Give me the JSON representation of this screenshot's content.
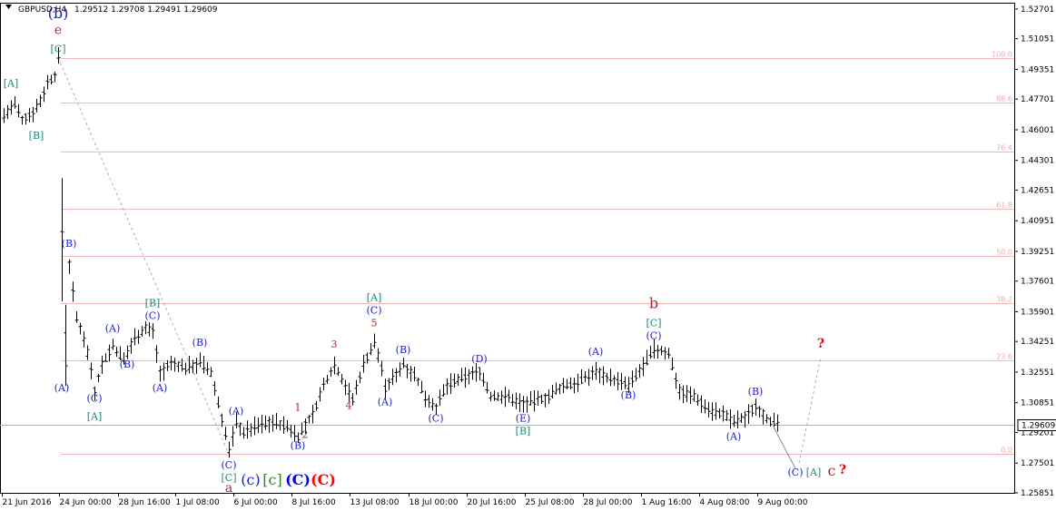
{
  "header": {
    "symbol": "GBPUSD,H4",
    "ohlc": "1.29512 1.29708 1.29491 1.29609"
  },
  "colors": {
    "background": "#ffffff",
    "candle": "#000000",
    "fib_line": "#f4b6b6",
    "fib_text": "#f4a6a6",
    "blue_label": "#1c1cd6",
    "teal_label": "#1a8a7a",
    "red_label": "#a52a2a",
    "green_label": "#2e7d32",
    "bright_blue": "#0000ff",
    "bright_red": "#ff0000",
    "current_price_line": "#b0b0b0",
    "trend_dash": "#b0b0b0"
  },
  "chart_data": {
    "type": "ohlc",
    "title": "",
    "y_axis": {
      "ticks": [
        "1.52701",
        "1.51051",
        "1.49351",
        "1.47701",
        "1.46001",
        "1.44301",
        "1.42651",
        "1.40951",
        "1.39251",
        "1.37601",
        "1.35901",
        "1.34251",
        "1.32551",
        "1.30851",
        "1.29201",
        "1.27501",
        "1.25851"
      ],
      "range": [
        1.2585,
        1.5305
      ],
      "current_price": "1.29609"
    },
    "x_axis": {
      "ticks": [
        "21 Jun 2016",
        "24 Jun 00:00",
        "28 Jun 16:00",
        "1 Jul 08:00",
        "6 Jul 00:00",
        "8 Jul 16:00",
        "13 Jul 08:00",
        "18 Jul 00:00",
        "20 Jul 16:00",
        "25 Jul 08:00",
        "28 Jul 00:00",
        "1 Aug 16:00",
        "4 Aug 08:00",
        "9 Aug 00:00"
      ]
    },
    "fib_levels": [
      {
        "label": "100.0",
        "price": 1.5
      },
      {
        "label": "88.6",
        "price": 1.475
      },
      {
        "label": "76.4",
        "price": 1.448
      },
      {
        "label": "61.8",
        "price": 1.416
      },
      {
        "label": "50.0",
        "price": 1.39
      },
      {
        "label": "38.2",
        "price": 1.364
      },
      {
        "label": "23.6",
        "price": 1.332
      },
      {
        "label": "0.0",
        "price": 1.28
      }
    ],
    "bar_count": 220,
    "bars": [],
    "wave_labels": [
      {
        "text": "(b)",
        "bar": 15,
        "price": 1.522,
        "color": "blue_label",
        "size": 16
      },
      {
        "text": "e",
        "bar": 15,
        "price": 1.513,
        "color": "red_label",
        "size": 14
      },
      {
        "text": "[C]",
        "bar": 15,
        "price": 1.503,
        "color": "teal_label",
        "size": 11
      },
      {
        "text": "[A]",
        "bar": 2,
        "price": 1.484,
        "color": "teal_label",
        "size": 11
      },
      {
        "text": "[B]",
        "bar": 9,
        "price": 1.455,
        "color": "teal_label",
        "size": 11
      },
      {
        "text": "(B)",
        "bar": 18,
        "price": 1.395,
        "color": "blue_label",
        "size": 11
      },
      {
        "text": "(A)",
        "bar": 16,
        "price": 1.315,
        "color": "blue_label",
        "size": 11
      },
      {
        "text": "(C)",
        "bar": 25,
        "price": 1.309,
        "color": "blue_label",
        "size": 11
      },
      {
        "text": "[A]",
        "bar": 25,
        "price": 1.299,
        "color": "teal_label",
        "size": 11
      },
      {
        "text": "(A)",
        "bar": 30,
        "price": 1.348,
        "color": "blue_label",
        "size": 11
      },
      {
        "text": "(B)",
        "bar": 34,
        "price": 1.328,
        "color": "blue_label",
        "size": 11
      },
      {
        "text": "[B]",
        "bar": 41,
        "price": 1.362,
        "color": "teal_label",
        "size": 11
      },
      {
        "text": "(C)",
        "bar": 41,
        "price": 1.355,
        "color": "blue_label",
        "size": 11
      },
      {
        "text": "(A)",
        "bar": 43,
        "price": 1.315,
        "color": "blue_label",
        "size": 11
      },
      {
        "text": "(B)",
        "bar": 54,
        "price": 1.34,
        "color": "blue_label",
        "size": 11
      },
      {
        "text": "(A)",
        "bar": 64,
        "price": 1.302,
        "color": "blue_label",
        "size": 11
      },
      {
        "text": "(C)",
        "bar": 62,
        "price": 1.272,
        "color": "blue_label",
        "size": 11
      },
      {
        "text": "[C]",
        "bar": 62,
        "price": 1.265,
        "color": "teal_label",
        "size": 11
      },
      {
        "text": "a",
        "bar": 62,
        "price": 1.259,
        "color": "red_label",
        "size": 14
      },
      {
        "text": "(c)",
        "bar": 68,
        "price": 1.263,
        "color": "blue_label",
        "size": 16
      },
      {
        "text": "[c]",
        "bar": 74,
        "price": 1.263,
        "color": "green_label",
        "size": 16
      },
      {
        "text": "(C)",
        "bar": 81,
        "price": 1.263,
        "color": "bright_blue",
        "size": 16
      },
      {
        "text": "(C)",
        "bar": 88,
        "price": 1.263,
        "color": "bright_red",
        "size": 16
      },
      {
        "text": "(B)",
        "bar": 81,
        "price": 1.283,
        "color": "blue_label",
        "size": 11
      },
      {
        "text": "1",
        "bar": 81,
        "price": 1.304,
        "color": "red_label",
        "size": 11
      },
      {
        "text": "2",
        "bar": 83,
        "price": 1.289,
        "color": "red_label",
        "size": 11
      },
      {
        "text": "3",
        "bar": 91,
        "price": 1.339,
        "color": "red_label",
        "size": 11
      },
      {
        "text": "4",
        "bar": 95,
        "price": 1.305,
        "color": "red_label",
        "size": 11
      },
      {
        "text": "[A]",
        "bar": 102,
        "price": 1.365,
        "color": "teal_label",
        "size": 11
      },
      {
        "text": "(C)",
        "bar": 102,
        "price": 1.358,
        "color": "blue_label",
        "size": 11
      },
      {
        "text": "5",
        "bar": 102,
        "price": 1.351,
        "color": "red_label",
        "size": 11
      },
      {
        "text": "(A)",
        "bar": 105,
        "price": 1.307,
        "color": "blue_label",
        "size": 11
      },
      {
        "text": "(B)",
        "bar": 110,
        "price": 1.336,
        "color": "blue_label",
        "size": 11
      },
      {
        "text": "(C)",
        "bar": 119,
        "price": 1.298,
        "color": "blue_label",
        "size": 11
      },
      {
        "text": "(D)",
        "bar": 131,
        "price": 1.331,
        "color": "blue_label",
        "size": 11
      },
      {
        "text": "(E)",
        "bar": 143,
        "price": 1.298,
        "color": "blue_label",
        "size": 11
      },
      {
        "text": "[B]",
        "bar": 143,
        "price": 1.291,
        "color": "teal_label",
        "size": 11
      },
      {
        "text": "(A)",
        "bar": 163,
        "price": 1.335,
        "color": "blue_label",
        "size": 11
      },
      {
        "text": "(B)",
        "bar": 172,
        "price": 1.311,
        "color": "blue_label",
        "size": 11
      },
      {
        "text": "b",
        "bar": 179,
        "price": 1.361,
        "color": "red_label",
        "size": 16
      },
      {
        "text": "[C]",
        "bar": 179,
        "price": 1.351,
        "color": "teal_label",
        "size": 11
      },
      {
        "text": "(C)",
        "bar": 179,
        "price": 1.344,
        "color": "blue_label",
        "size": 11
      },
      {
        "text": "(A)",
        "bar": 201,
        "price": 1.288,
        "color": "blue_label",
        "size": 11
      },
      {
        "text": "(B)",
        "bar": 207,
        "price": 1.313,
        "color": "blue_label",
        "size": 11
      },
      {
        "text": "(C)",
        "bar": 218,
        "price": 1.268,
        "color": "blue_label",
        "size": 11
      },
      {
        "text": "[A]",
        "bar": 223,
        "price": 1.268,
        "color": "teal_label",
        "size": 11
      },
      {
        "text": "c",
        "bar": 228,
        "price": 1.268,
        "color": "red_label",
        "size": 16
      },
      {
        "text": "?",
        "bar": 231,
        "price": 1.269,
        "color": "bright_red",
        "size": 14
      },
      {
        "text": "?",
        "bar": 225,
        "price": 1.339,
        "color": "bright_red",
        "size": 14
      }
    ]
  }
}
